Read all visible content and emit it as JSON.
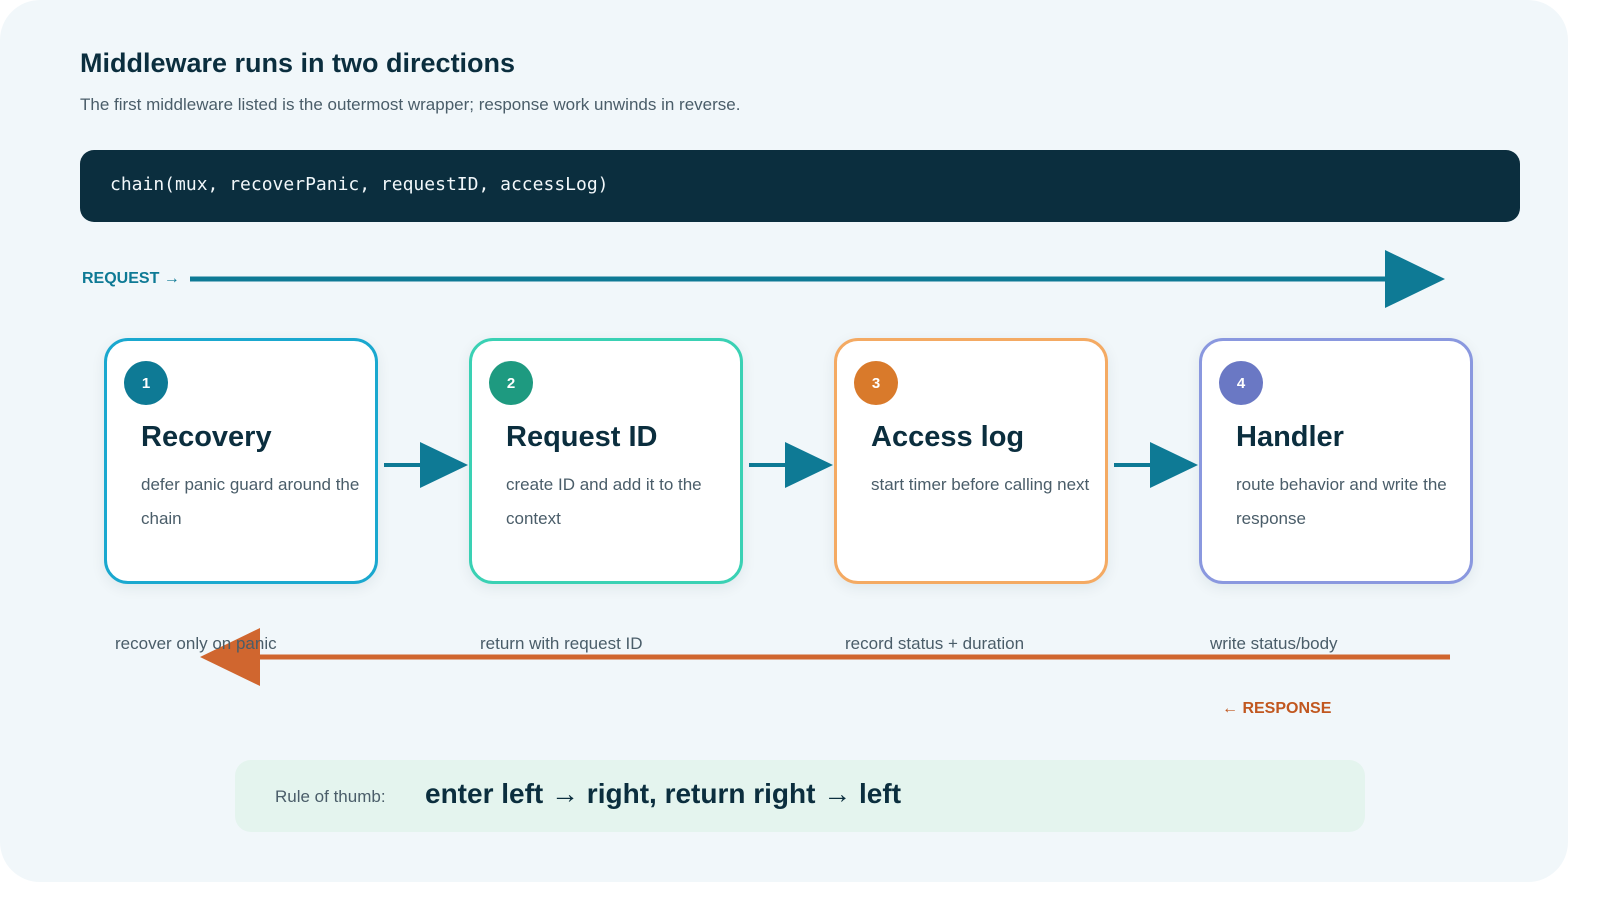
{
  "title": "Middleware runs in two directions",
  "subtitle": "The first middleware listed is the outermost wrapper; response work unwinds in reverse.",
  "code": "chain(mux, recoverPanic, requestID, accessLog)",
  "request_label": "REQUEST →",
  "response_label": "← RESPONSE",
  "colors": {
    "request_arrow": "#0e7a95",
    "response_arrow": "#d0662f",
    "code_bg": "#0b2e3e"
  },
  "steps": [
    {
      "number": "1",
      "title": "Recovery",
      "desc": "defer panic guard around the chain",
      "border": "#1aa8cf",
      "badge": "#0e7a95"
    },
    {
      "number": "2",
      "title": "Request ID",
      "desc": "create ID and add it to the context",
      "border": "#3ad1b4",
      "badge": "#1e9a80"
    },
    {
      "number": "3",
      "title": "Access log",
      "desc": "start timer before calling next",
      "border": "#f4aa63",
      "badge": "#d97a2b"
    },
    {
      "number": "4",
      "title": "Handler",
      "desc": "route behavior and write the response",
      "border": "#8a98df",
      "badge": "#6a78c4"
    }
  ],
  "response_notes": [
    "recover only on panic",
    "return with request ID",
    "record status + duration",
    "write status/body"
  ],
  "rule": {
    "label": "Rule of thumb:",
    "text": "enter left → right, return right → left"
  }
}
